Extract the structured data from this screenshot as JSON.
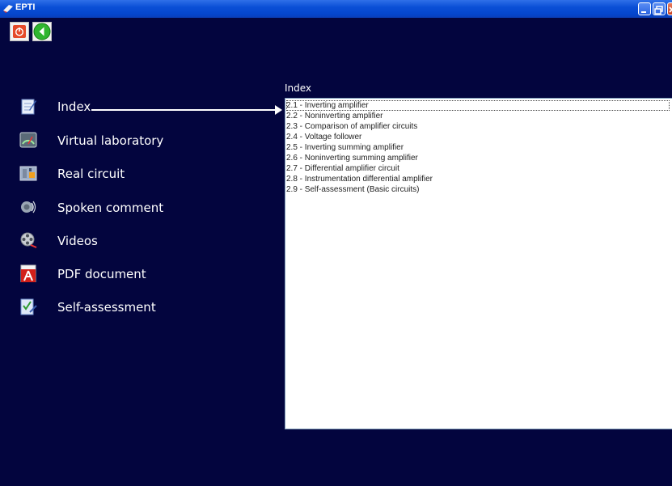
{
  "window": {
    "title": "EPTI"
  },
  "toolbar": {
    "power_icon": "power-icon",
    "back_icon": "back-arrow-icon"
  },
  "menu": {
    "items": [
      {
        "label": "Index",
        "icon": "notepad-icon"
      },
      {
        "label": "Virtual laboratory",
        "icon": "gauge-icon"
      },
      {
        "label": "Real circuit",
        "icon": "circuit-board-icon"
      },
      {
        "label": "Spoken comment",
        "icon": "speaker-icon"
      },
      {
        "label": "Videos",
        "icon": "film-reel-icon"
      },
      {
        "label": "PDF document",
        "icon": "pdf-icon"
      },
      {
        "label": "Self-assessment",
        "icon": "checklist-icon"
      }
    ]
  },
  "index_panel": {
    "title": "Index",
    "items": [
      "2.1 - Inverting amplifier",
      "2.2 - Noninverting amplifier",
      "2.3 - Comparison of amplifier circuits",
      "2.4 - Voltage follower",
      "2.5 - Inverting summing amplifier",
      "2.6 - Noninverting summing amplifier",
      "2.7 - Differential amplifier circuit",
      "2.8 - Instrumentation differential amplifier",
      "2.9 - Self-assessment (Basic circuits)"
    ]
  },
  "colors": {
    "background": "#03053e",
    "titlebar": "#0a4fd6",
    "text": "#ffffff"
  }
}
